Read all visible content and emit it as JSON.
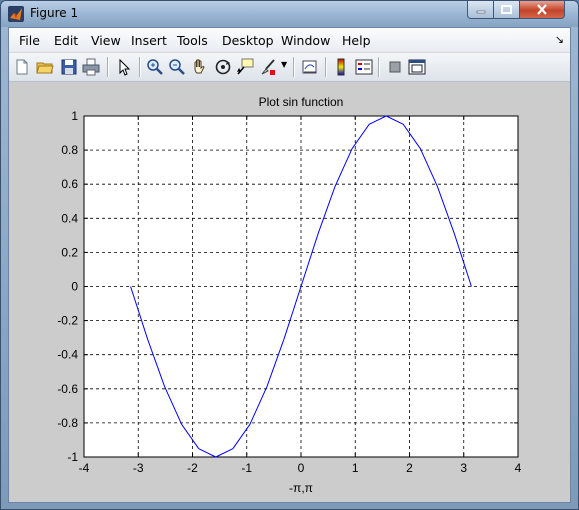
{
  "window": {
    "title": "Figure 1"
  },
  "menu": {
    "items": [
      "File",
      "Edit",
      "View",
      "Insert",
      "Tools",
      "Desktop",
      "Window",
      "Help"
    ]
  },
  "toolbar": {
    "buttons": [
      "new-figure",
      "open-file",
      "save-figure",
      "print-figure",
      "edit-plot",
      "zoom-in",
      "zoom-out",
      "pan",
      "rotate-3d",
      "data-cursor",
      "brush",
      "insert-colorbar",
      "link-plot",
      "insert-legend",
      "hide-plot-tools",
      "show-plot-tools"
    ]
  },
  "colors": {
    "line": "#0000ff",
    "axes_bg": "#ffffff",
    "figure_bg": "#cccccc"
  },
  "chart_data": {
    "type": "line",
    "title": "Plot sin function",
    "xlabel": "-π,π",
    "ylabel": "",
    "xlim": [
      -4,
      4
    ],
    "ylim": [
      -1,
      1
    ],
    "xticks": [
      "-4",
      "-3",
      "-2",
      "-1",
      "0",
      "1",
      "2",
      "3",
      "4"
    ],
    "yticks": [
      "-1",
      "-0.8",
      "-0.6",
      "-0.4",
      "-0.2",
      "0",
      "0.2",
      "0.4",
      "0.6",
      "0.8",
      "1"
    ],
    "grid": true,
    "series": [
      {
        "x": [
          -3.1416,
          -2.8274,
          -2.5133,
          -2.1991,
          -1.885,
          -1.5708,
          -1.2566,
          -0.9425,
          -0.6283,
          -0.3142,
          0,
          0.3142,
          0.6283,
          0.9425,
          1.2566,
          1.5708,
          1.885,
          2.1991,
          2.5133,
          2.8274,
          3.1416
        ],
        "y": [
          0,
          -0.309,
          -0.5878,
          -0.809,
          -0.9511,
          -1,
          -0.9511,
          -0.809,
          -0.5878,
          -0.309,
          0,
          0.309,
          0.5878,
          0.809,
          0.9511,
          1,
          0.9511,
          0.809,
          0.5878,
          0.309,
          0
        ]
      }
    ]
  }
}
